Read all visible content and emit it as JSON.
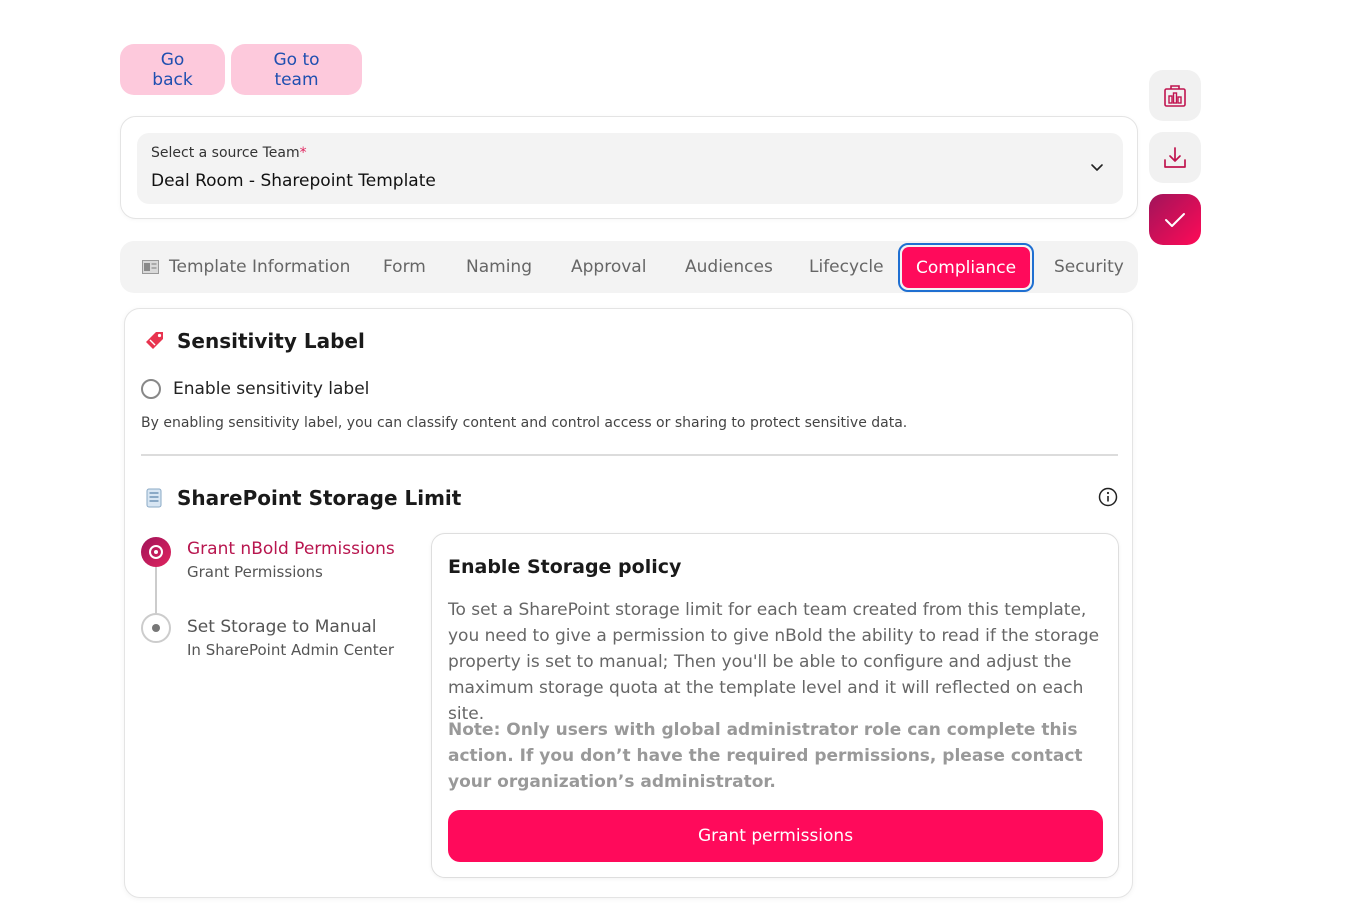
{
  "nav": {
    "back_label": "Go back",
    "team_label": "Go to team"
  },
  "source": {
    "label": "Select a source Team",
    "required_mark": "*",
    "value": "Deal Room - Sharepoint Template"
  },
  "side_actions": [
    "report-icon",
    "download-icon",
    "check-icon"
  ],
  "tabs": [
    {
      "label": "Template Information",
      "icon": "template-icon"
    },
    {
      "label": "Form"
    },
    {
      "label": "Naming"
    },
    {
      "label": "Approval"
    },
    {
      "label": "Audiences"
    },
    {
      "label": "Lifecycle"
    },
    {
      "label": "Compliance",
      "active": true
    },
    {
      "label": "Security"
    }
  ],
  "sensitivity": {
    "title": "Sensitivity Label",
    "checkbox_label": "Enable sensitivity label",
    "description": "By enabling sensitivity label, you can classify content and control access or sharing to protect sensitive data."
  },
  "storage": {
    "title": "SharePoint Storage Limit",
    "steps": [
      {
        "title": "Grant nBold Permissions",
        "subtitle": "Grant Permissions",
        "state": "active"
      },
      {
        "title": "Set Storage to Manual",
        "subtitle": "In SharePoint Admin Center",
        "state": "pending"
      }
    ],
    "policy": {
      "title": "Enable Storage policy",
      "body": "To set a SharePoint storage limit for each team created from this template, you need to give a permission to give nBold the ability to read if the storage property is set to manual; Then you'll be able to configure and adjust the maximum storage quota at the template level and it will reflected on each site.",
      "note": "Note: Only users with global administrator role can complete this action. If you don’t have the required permissions, please contact your organization’s administrator.",
      "button_label": "Grant permissions"
    }
  },
  "colors": {
    "accent": "#ff0a5b",
    "accent_dark": "#a0145a",
    "pill_bg": "#fdc9dc",
    "link_blue": "#1f4fb0",
    "focus_ring": "#1f6fd1"
  }
}
